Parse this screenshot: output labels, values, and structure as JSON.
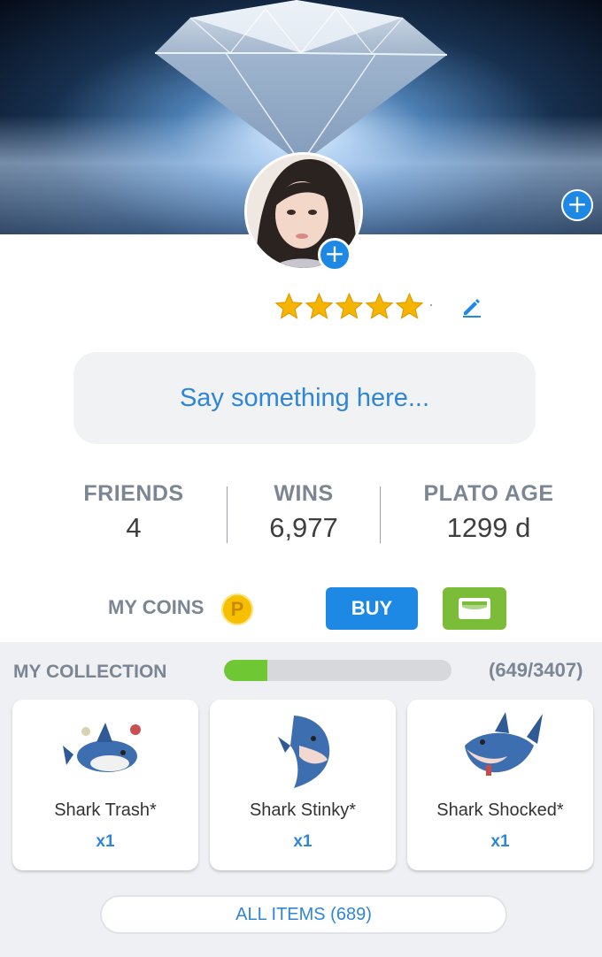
{
  "profile": {
    "rating_stars": 5,
    "status_placeholder": "Say something here...",
    "stats": [
      {
        "label": "FRIENDS",
        "value": "4"
      },
      {
        "label": "WINS",
        "value": "6,977"
      },
      {
        "label": "PLATO AGE",
        "value": "1299 d"
      }
    ]
  },
  "coins": {
    "label": "MY COINS",
    "coin_symbol": "P",
    "buy_label": "BUY"
  },
  "collection": {
    "label": "MY COLLECTION",
    "progress_fraction": 0.1905,
    "count_text": "(649/3407)",
    "items": [
      {
        "name": "Shark Trash*",
        "qty": "x1"
      },
      {
        "name": "Shark Stinky*",
        "qty": "x1"
      },
      {
        "name": "Shark Shocked*",
        "qty": "x1"
      }
    ],
    "all_items_label": "ALL ITEMS (689)"
  },
  "colors": {
    "accent_blue": "#1e88e5",
    "star_gold": "#f5b400",
    "progress_green": "#6ec733",
    "wallet_green": "#7bbd39"
  },
  "icons": {
    "banner_add": "plus-circle-icon",
    "avatar_add": "plus-circle-icon",
    "edit": "pencil-icon",
    "coin": "plato-coin-icon",
    "wallet": "wallet-icon"
  }
}
